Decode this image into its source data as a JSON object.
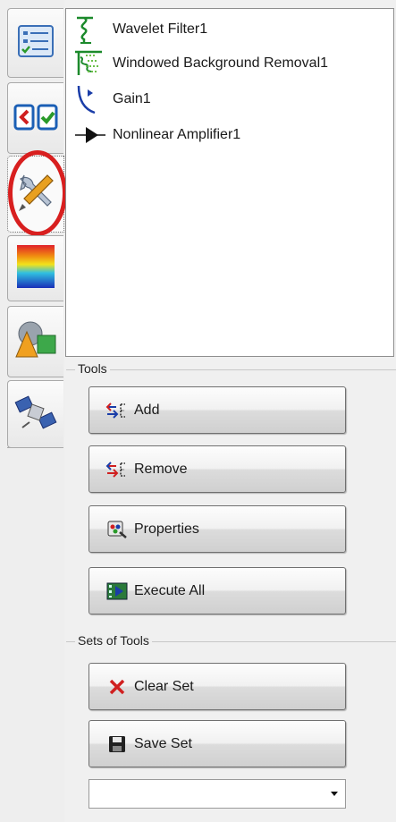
{
  "tabs": [
    {
      "icon": "checklist-icon"
    },
    {
      "icon": "compare-icon"
    },
    {
      "icon": "tools-icon",
      "active": true
    },
    {
      "icon": "color-palette-icon"
    },
    {
      "icon": "3d-shapes-icon"
    },
    {
      "icon": "satellite-icon"
    }
  ],
  "tree": {
    "items": [
      {
        "label": "Wavelet Filter1",
        "icon": "wavelet-filter-icon"
      },
      {
        "label": "Windowed Background Removal1",
        "icon": "background-removal-icon"
      },
      {
        "label": "Gain1",
        "icon": "gain-icon"
      },
      {
        "label": "Nonlinear Amplifier1",
        "icon": "amplifier-icon"
      }
    ]
  },
  "tools": {
    "group_label": "Tools",
    "add_label": "Add",
    "remove_label": "Remove",
    "properties_label": "Properties",
    "execute_all_label": "Execute All"
  },
  "sets": {
    "group_label": "Sets of Tools",
    "clear_label": "Clear Set",
    "save_label": "Save Set",
    "dropdown_value": ""
  },
  "colors": {
    "highlight": "#d81f1f",
    "tree_icon_green": "#1c8a2c",
    "tree_icon_blue": "#1a3da8"
  }
}
